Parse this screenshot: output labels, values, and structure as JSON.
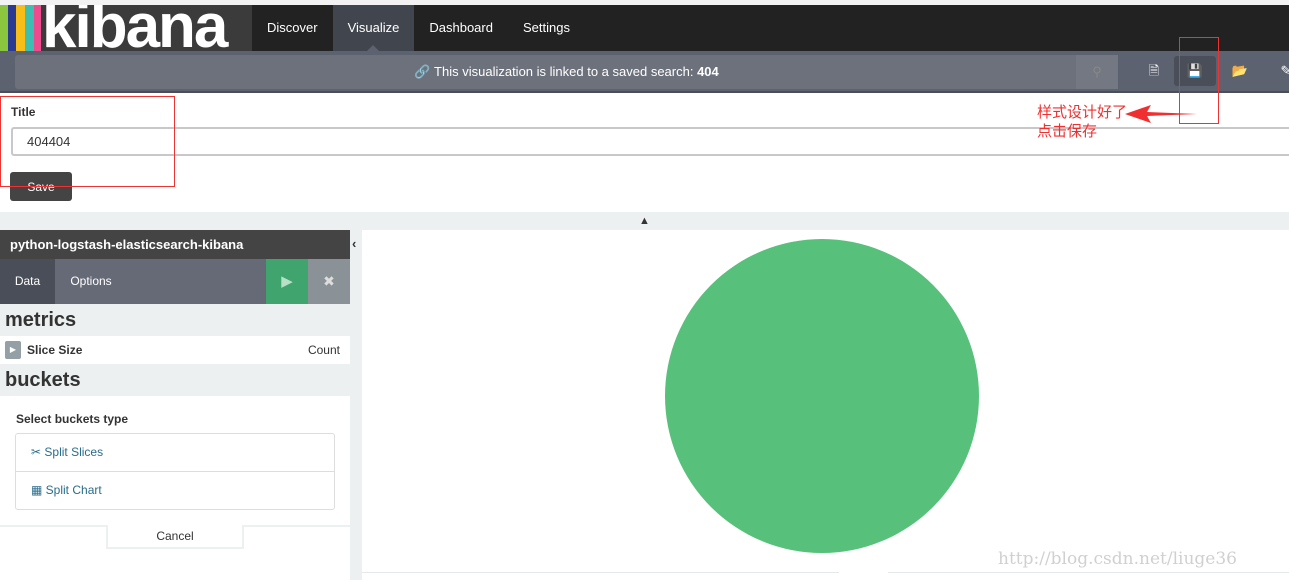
{
  "app": {
    "logo_text": "kibana",
    "logo_colors": [
      "#8cc63f",
      "#2b3990",
      "#f7be1a",
      "#3ebeb0",
      "#ed4b8d"
    ]
  },
  "nav": {
    "items": [
      {
        "label": "Discover"
      },
      {
        "label": "Visualize",
        "active": true
      },
      {
        "label": "Dashboard"
      },
      {
        "label": "Settings"
      }
    ]
  },
  "toolbar": {
    "linked_text": "This visualization is linked to a saved search: ",
    "linked_name": "404",
    "icons": [
      "search-icon",
      "new-icon",
      "save-icon",
      "open-icon",
      "share-icon"
    ]
  },
  "form": {
    "title_label": "Title",
    "title_value": "404404",
    "save_label": "Save"
  },
  "annotation": {
    "line1": "样式设计好了",
    "line2": "点击保存",
    "color": "#f03030"
  },
  "sidebar": {
    "index_name": "python-logstash-elasticsearch-kibana",
    "tabs": [
      {
        "label": "Data"
      },
      {
        "label": "Options"
      }
    ],
    "metrics_heading": "metrics",
    "metric": {
      "label": "Slice Size",
      "value": "Count"
    },
    "buckets_heading": "buckets",
    "select_label": "Select buckets type",
    "bucket_options": [
      {
        "label": "Split Slices"
      },
      {
        "label": "Split Chart"
      }
    ],
    "cancel_label": "Cancel"
  },
  "colors": {
    "accent_green": "#3fa46d",
    "pie": "#57c17b"
  },
  "chart_data": {
    "type": "pie",
    "slices": [
      {
        "share": 1,
        "color": "#57c17b"
      }
    ]
  },
  "watermark": "http://blog.csdn.net/liuge36"
}
